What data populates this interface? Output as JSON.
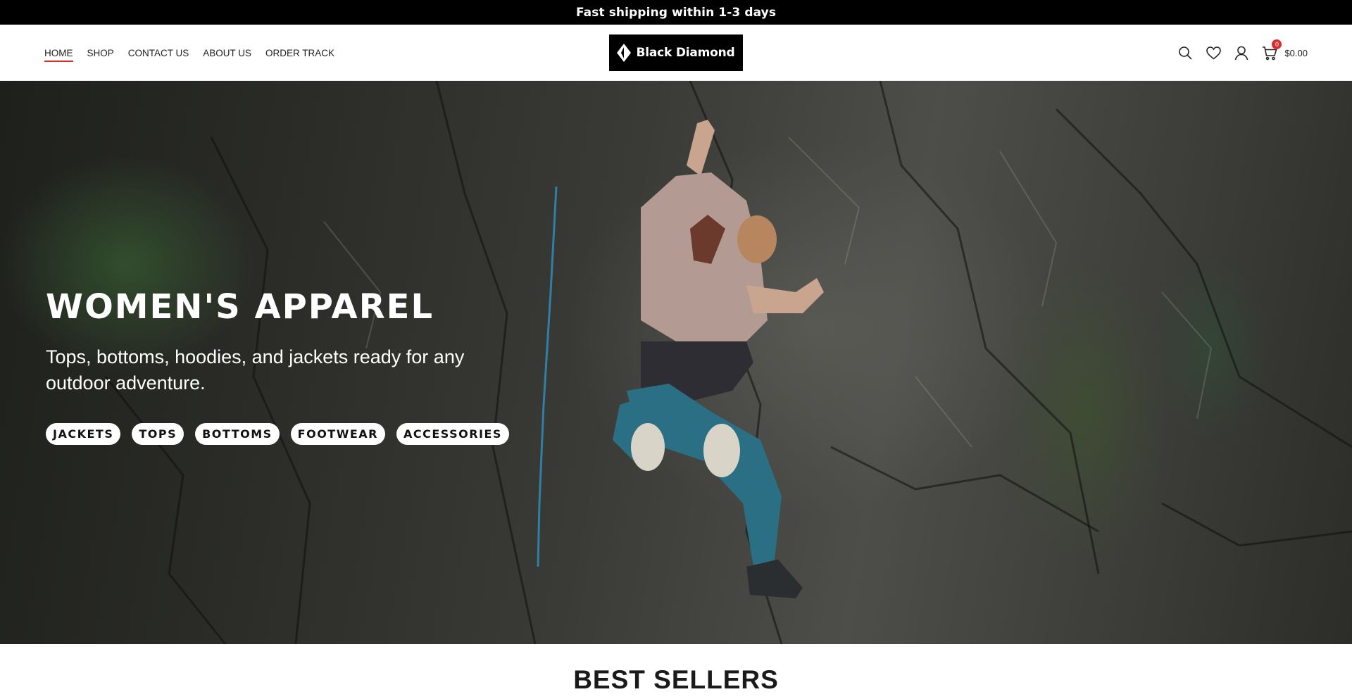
{
  "announcement": "Fast shipping within 1-3 days",
  "nav": {
    "items": [
      {
        "label": "HOME",
        "active": true
      },
      {
        "label": "SHOP",
        "active": false
      },
      {
        "label": "CONTACT US",
        "active": false
      },
      {
        "label": "ABOUT US",
        "active": false
      },
      {
        "label": "ORDER TRACK",
        "active": false
      }
    ]
  },
  "logo": {
    "text": "Black Diamond"
  },
  "header_actions": {
    "icons": [
      "search-icon",
      "heart-icon",
      "user-icon",
      "cart-icon"
    ],
    "cart_count": "0",
    "cart_total": "$0.00"
  },
  "hero": {
    "title": "WOMEN'S APPAREL",
    "subtitle": "Tops, bottoms, hoodies, and jackets ready for any outdoor adventure.",
    "pills": [
      "JACKETS",
      "TOPS",
      "BOTTOMS",
      "FOOTWEAR",
      "ACCESSORIES"
    ]
  },
  "section": {
    "title": "BEST SELLERS"
  },
  "colors": {
    "accent": "#d32f2f",
    "announcement_bg": "#000000",
    "logo_bg": "#000000"
  }
}
